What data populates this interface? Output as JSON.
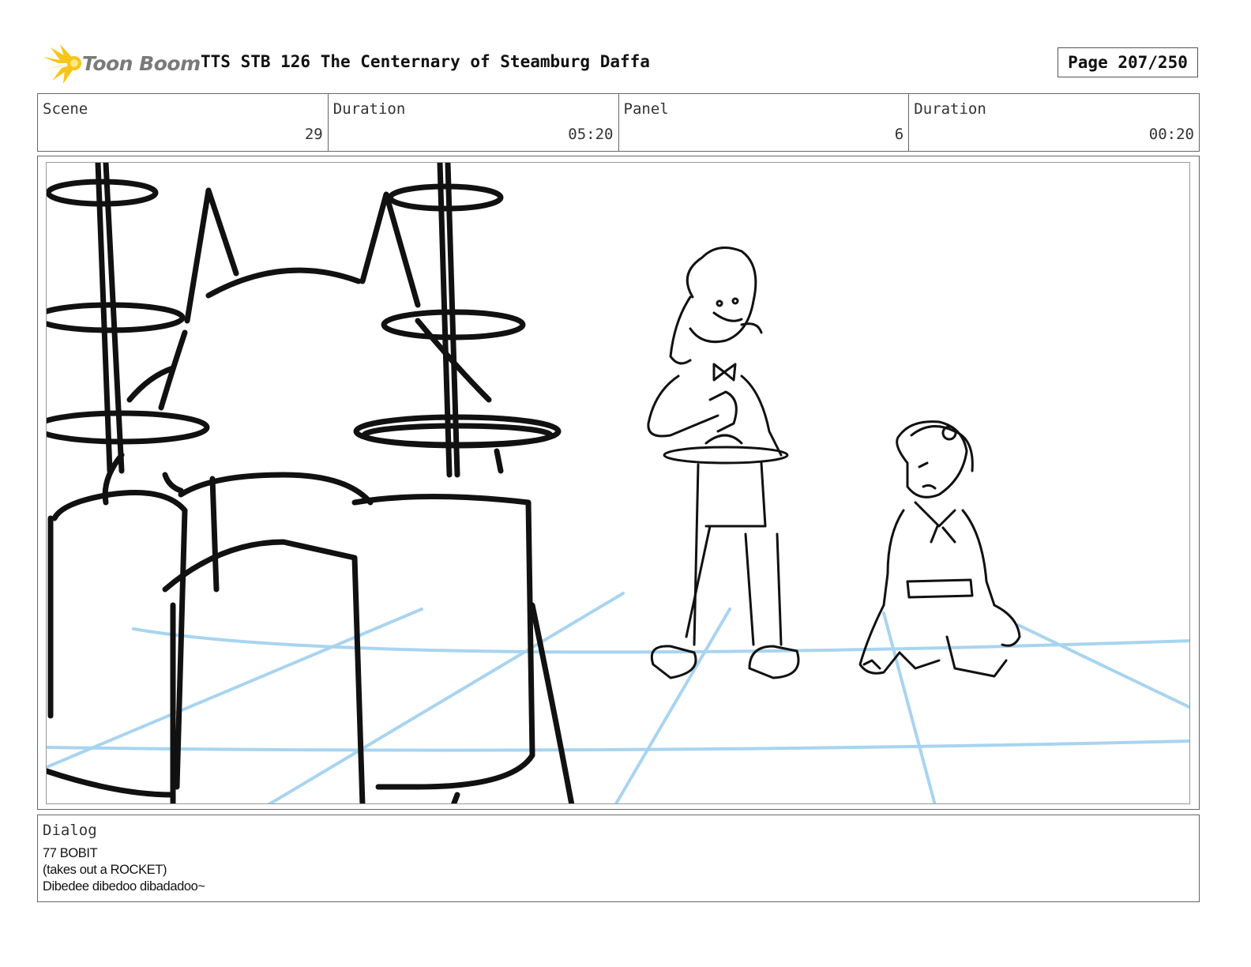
{
  "header": {
    "logo_text": "Toon Boom",
    "title": "TTS STB 126 The Centernary of Steamburg Daffa",
    "page": "Page 207/250"
  },
  "info": {
    "scene_label": "Scene",
    "scene_value": "29",
    "duration_label": "Duration",
    "duration_value": "05:20",
    "panel_label": "Panel",
    "panel_value": "6",
    "panel_duration_label": "Duration",
    "panel_duration_value": "00:20"
  },
  "dialog": {
    "label": "Dialog",
    "lines": [
      "77 BOBIT",
      "(takes out a ROCKET)",
      "Dibedee dibedoo dibadadoo~"
    ]
  },
  "colors": {
    "logo_star": "#f5c518",
    "guide_lines": "#a8d4f0",
    "ink": "#111111"
  }
}
